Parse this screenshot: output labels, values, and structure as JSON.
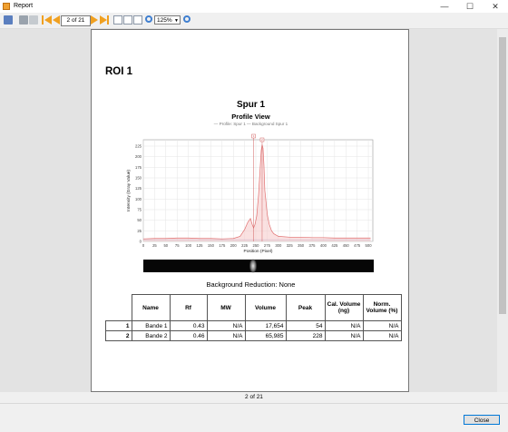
{
  "window": {
    "title": "Report",
    "minimize_glyph": "—",
    "maximize_glyph": "☐",
    "close_glyph": "✕"
  },
  "toolbar": {
    "page_indicator": "2 of 21",
    "zoom_value": "125%",
    "icons": [
      "save-icon",
      "print-icon",
      "email-icon",
      "link-icon",
      "first-page-icon",
      "previous-page-icon",
      "next-page-icon",
      "last-page-icon",
      "single-page-icon",
      "fit-width-icon",
      "fit-page-icon",
      "zoom-out-icon",
      "zoom-in-icon"
    ]
  },
  "report": {
    "roi_title": "ROI 1",
    "chart_title": "Spur 1",
    "chart_subtitle": "Profile View",
    "legend_text": "— Profile: Spur 1 — Background Spur 1",
    "background_reduction": "Background Reduction: None"
  },
  "chart_data": {
    "type": "area",
    "title": "Spur 1",
    "subtitle": "Profile View",
    "xlabel": "Position (Pixel)",
    "ylabel": "Intensity (Gray Value)",
    "xlim": [
      0,
      510
    ],
    "ylim": [
      0,
      240
    ],
    "x_ticks": [
      0,
      25,
      50,
      75,
      100,
      125,
      150,
      175,
      200,
      225,
      250,
      275,
      300,
      325,
      350,
      375,
      400,
      425,
      450,
      475,
      500
    ],
    "y_ticks": [
      0,
      25,
      50,
      75,
      100,
      125,
      150,
      175,
      200,
      225
    ],
    "grid": true,
    "series": [
      {
        "name": "Profile: Spur 1",
        "color": "#e07070",
        "x": [
          0,
          25,
          50,
          75,
          100,
          125,
          150,
          175,
          200,
          215,
          225,
          232,
          238,
          242,
          245,
          248,
          252,
          256,
          260,
          262,
          264,
          266,
          268,
          270,
          272,
          274,
          276,
          280,
          285,
          290,
          300,
          325,
          350,
          375,
          400,
          425,
          450,
          475,
          505
        ],
        "y": [
          6,
          7,
          7,
          8,
          8,
          7,
          7,
          6,
          7,
          12,
          28,
          45,
          54,
          40,
          32,
          40,
          60,
          110,
          180,
          215,
          228,
          220,
          180,
          120,
          100,
          78,
          60,
          40,
          25,
          18,
          12,
          10,
          10,
          9,
          9,
          8,
          8,
          8,
          8
        ]
      },
      {
        "name": "Background Spur 1",
        "color": "#9090c0",
        "x": [
          0,
          505
        ],
        "y": [
          4,
          4
        ]
      }
    ],
    "peak_markers": [
      {
        "label": "1",
        "x": 245
      },
      {
        "label": "2",
        "x": 264
      }
    ]
  },
  "table": {
    "headers": [
      "",
      "Name",
      "Rf",
      "MW",
      "Volume",
      "Peak",
      "Cal. Volume (ng)",
      "Norm. Volume (%)"
    ],
    "rows": [
      [
        "1",
        "Bande 1",
        "0.43",
        "N/A",
        "17,654",
        "54",
        "N/A",
        "N/A"
      ],
      [
        "2",
        "Bande 2",
        "0.46",
        "N/A",
        "65,985",
        "228",
        "N/A",
        "N/A"
      ]
    ]
  },
  "status": {
    "page_text": "2 of 21"
  },
  "buttons": {
    "close_label": "Close"
  }
}
